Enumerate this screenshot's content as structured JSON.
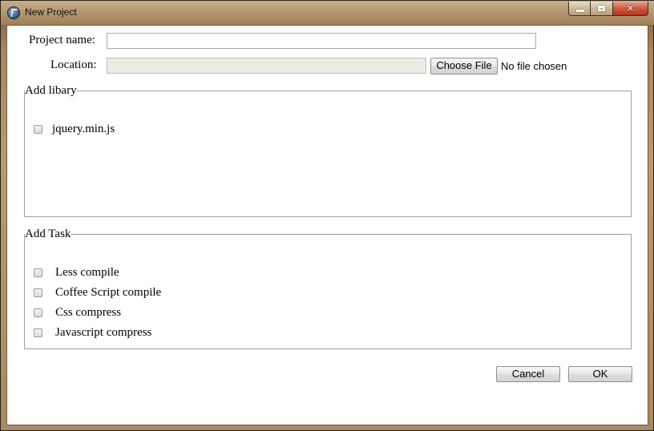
{
  "window": {
    "title": "New Project",
    "controls": {
      "minimize": "minimize",
      "maximize": "maximize",
      "close": "close"
    }
  },
  "form": {
    "project_name_label": "Project name:",
    "project_name_value": "",
    "location_label": "Location:",
    "location_value": "",
    "choose_file_label": "Choose File",
    "no_file_text": "No file chosen"
  },
  "library": {
    "legend": "Add libary",
    "items": [
      {
        "label": "jquery.min.js",
        "checked": false
      }
    ]
  },
  "tasks": {
    "legend": "Add Task",
    "items": [
      {
        "label": "Less compile",
        "checked": false
      },
      {
        "label": "Coffee Script compile",
        "checked": false
      },
      {
        "label": "Css compress",
        "checked": false
      },
      {
        "label": "Javascript compress",
        "checked": false
      }
    ]
  },
  "buttons": {
    "cancel_label": "Cancel",
    "ok_label": "OK"
  },
  "colors": {
    "frame": "#a6865f",
    "close_button": "#cf5b3c"
  }
}
